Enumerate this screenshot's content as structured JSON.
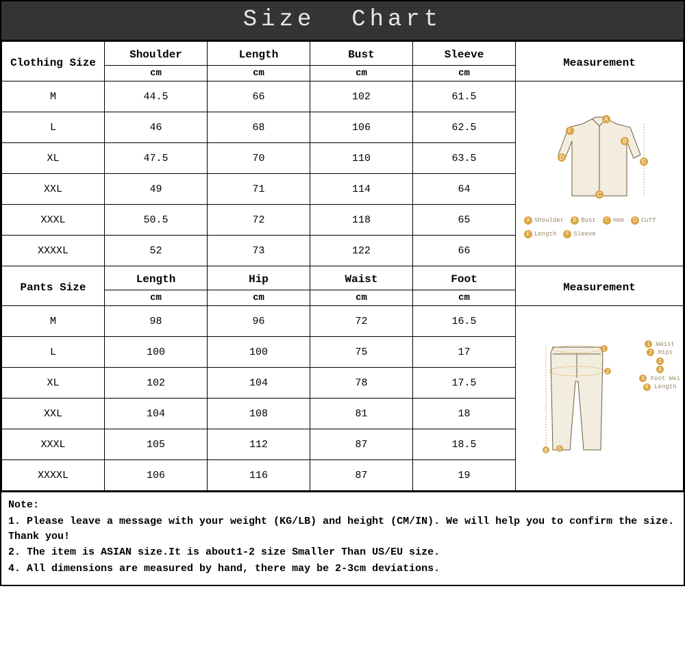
{
  "title": "Size  Chart",
  "clothing": {
    "size_header": "Clothing Size",
    "meas_header": "Measurement",
    "cols": [
      {
        "name": "Shoulder",
        "unit": "cm"
      },
      {
        "name": "Length",
        "unit": "cm"
      },
      {
        "name": "Bust",
        "unit": "cm"
      },
      {
        "name": "Sleeve",
        "unit": "cm"
      }
    ],
    "rows": [
      {
        "size": "M",
        "v": [
          "44.5",
          "66",
          "102",
          "61.5"
        ]
      },
      {
        "size": "L",
        "v": [
          "46",
          "68",
          "106",
          "62.5"
        ]
      },
      {
        "size": "XL",
        "v": [
          "47.5",
          "70",
          "110",
          "63.5"
        ]
      },
      {
        "size": "XXL",
        "v": [
          "49",
          "71",
          "114",
          "64"
        ]
      },
      {
        "size": "XXXL",
        "v": [
          "50.5",
          "72",
          "118",
          "65"
        ]
      },
      {
        "size": "XXXXL",
        "v": [
          "52",
          "73",
          "122",
          "66"
        ]
      }
    ],
    "legend": [
      {
        "key": "A",
        "label": "Shoulder"
      },
      {
        "key": "B",
        "label": "Bust"
      },
      {
        "key": "C",
        "label": "Hem"
      },
      {
        "key": "D",
        "label": "Cuff"
      },
      {
        "key": "E",
        "label": "Length"
      },
      {
        "key": "F",
        "label": "Sleeve"
      }
    ]
  },
  "pants": {
    "size_header": "Pants Size",
    "meas_header": "Measurement",
    "cols": [
      {
        "name": "Length",
        "unit": "cm"
      },
      {
        "name": "Hip",
        "unit": "cm"
      },
      {
        "name": "Waist",
        "unit": "cm"
      },
      {
        "name": "Foot",
        "unit": "cm"
      }
    ],
    "rows": [
      {
        "size": "M",
        "v": [
          "98",
          "96",
          "72",
          "16.5"
        ]
      },
      {
        "size": "L",
        "v": [
          "100",
          "100",
          "75",
          "17"
        ]
      },
      {
        "size": "XL",
        "v": [
          "102",
          "104",
          "78",
          "17.5"
        ]
      },
      {
        "size": "XXL",
        "v": [
          "104",
          "108",
          "81",
          "18"
        ]
      },
      {
        "size": "XXXL",
        "v": [
          "105",
          "112",
          "87",
          "18.5"
        ]
      },
      {
        "size": "XXXXL",
        "v": [
          "106",
          "116",
          "87",
          "19"
        ]
      }
    ],
    "legend": [
      {
        "key": "1",
        "label": "Waist"
      },
      {
        "key": "2",
        "label": "Hips"
      },
      {
        "key": "3",
        "label": ""
      },
      {
        "key": "4",
        "label": ""
      },
      {
        "key": "5",
        "label": "Foot Wai"
      },
      {
        "key": "6",
        "label": "Length"
      }
    ]
  },
  "notes": {
    "heading": "Note:",
    "lines": [
      "1. Please leave a message with your weight (KG/LB) and height (CM/IN). We will help you to confirm the size. Thank you!",
      "2. The item is ASIAN size.It is about1-2 size Smaller Than US/EU size.",
      "4. All dimensions are measured by hand, there may be 2-3cm deviations."
    ]
  }
}
